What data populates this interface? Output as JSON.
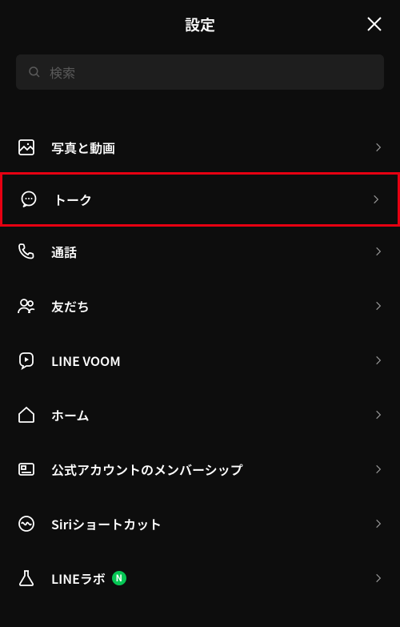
{
  "header": {
    "title": "設定"
  },
  "search": {
    "placeholder": "検索"
  },
  "rows": {
    "photos_videos": {
      "label": "写真と動画"
    },
    "talk": {
      "label": "トーク"
    },
    "calls": {
      "label": "通話"
    },
    "friends": {
      "label": "友だち"
    },
    "voom": {
      "label": "LINE VOOM"
    },
    "home": {
      "label": "ホーム"
    },
    "official_membership": {
      "label": "公式アカウントのメンバーシップ"
    },
    "siri": {
      "label": "Siriショートカット"
    },
    "labs": {
      "label": "LINEラボ",
      "badge": "N"
    }
  }
}
